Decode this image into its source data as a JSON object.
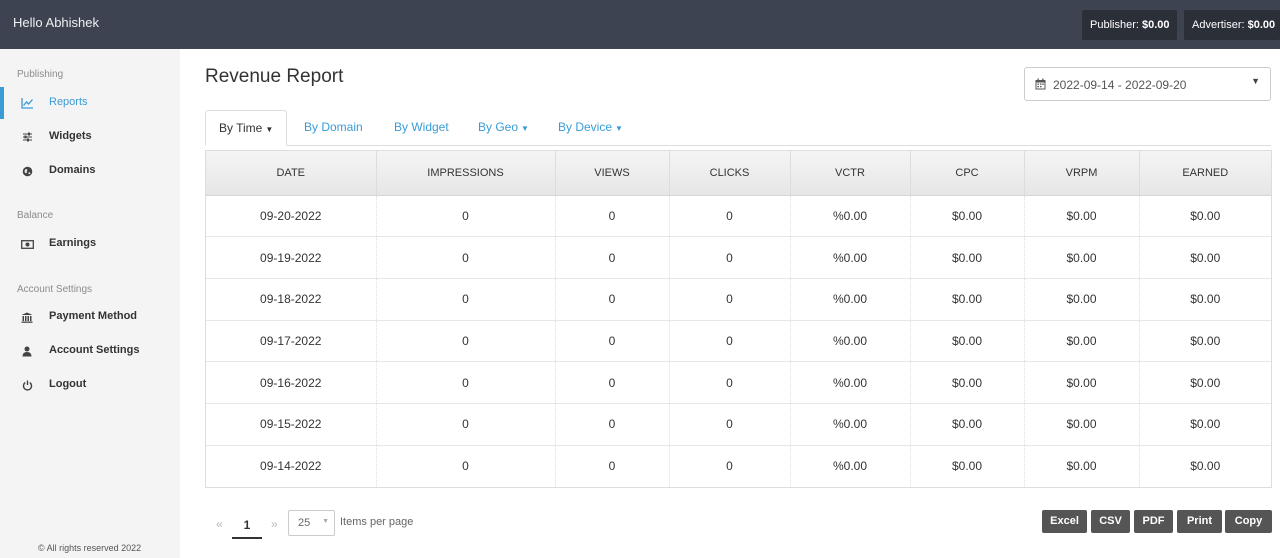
{
  "header": {
    "greeting": "Hello Abhishek",
    "publisher_label": "Publisher:",
    "publisher_value": "$0.00",
    "advertiser_label": "Advertiser:",
    "advertiser_value": "$0.00"
  },
  "sidebar": {
    "sections": {
      "publishing": "Publishing",
      "balance": "Balance",
      "account": "Account Settings"
    },
    "items": {
      "reports": {
        "label": "Reports",
        "icon": "line-chart-icon"
      },
      "widgets": {
        "label": "Widgets",
        "icon": "sliders-icon"
      },
      "domains": {
        "label": "Domains",
        "icon": "globe-icon"
      },
      "earnings": {
        "label": "Earnings",
        "icon": "money-icon"
      },
      "payment_method": {
        "label": "Payment Method",
        "icon": "bank-icon"
      },
      "account_settings": {
        "label": "Account Settings",
        "icon": "user-icon"
      },
      "logout": {
        "label": "Logout",
        "icon": "power-icon"
      }
    },
    "footer": "© All rights reserved 2022"
  },
  "main": {
    "title": "Revenue Report",
    "date_range": "2022-09-14 - 2022-09-20",
    "tabs": {
      "by_time": "By Time",
      "by_domain": "By Domain",
      "by_widget": "By Widget",
      "by_geo": "By Geo",
      "by_device": "By Device"
    }
  },
  "table": {
    "columns": [
      "DATE",
      "IMPRESSIONS",
      "VIEWS",
      "CLICKS",
      "VCTR",
      "CPC",
      "VRPM",
      "EARNED"
    ],
    "rows": [
      [
        "09-20-2022",
        "0",
        "0",
        "0",
        "%0.00",
        "$0.00",
        "$0.00",
        "$0.00"
      ],
      [
        "09-19-2022",
        "0",
        "0",
        "0",
        "%0.00",
        "$0.00",
        "$0.00",
        "$0.00"
      ],
      [
        "09-18-2022",
        "0",
        "0",
        "0",
        "%0.00",
        "$0.00",
        "$0.00",
        "$0.00"
      ],
      [
        "09-17-2022",
        "0",
        "0",
        "0",
        "%0.00",
        "$0.00",
        "$0.00",
        "$0.00"
      ],
      [
        "09-16-2022",
        "0",
        "0",
        "0",
        "%0.00",
        "$0.00",
        "$0.00",
        "$0.00"
      ],
      [
        "09-15-2022",
        "0",
        "0",
        "0",
        "%0.00",
        "$0.00",
        "$0.00",
        "$0.00"
      ],
      [
        "09-14-2022",
        "0",
        "0",
        "0",
        "%0.00",
        "$0.00",
        "$0.00",
        "$0.00"
      ]
    ]
  },
  "pager": {
    "prev": "«",
    "page": "1",
    "next": "»",
    "page_size": "25",
    "items_label": "Items per page"
  },
  "export": {
    "excel": "Excel",
    "csv": "CSV",
    "pdf": "PDF",
    "print": "Print",
    "copy": "Copy"
  },
  "colors": {
    "topbar": "#3d4350",
    "accent": "#3a9cd6",
    "button": "#555555"
  }
}
